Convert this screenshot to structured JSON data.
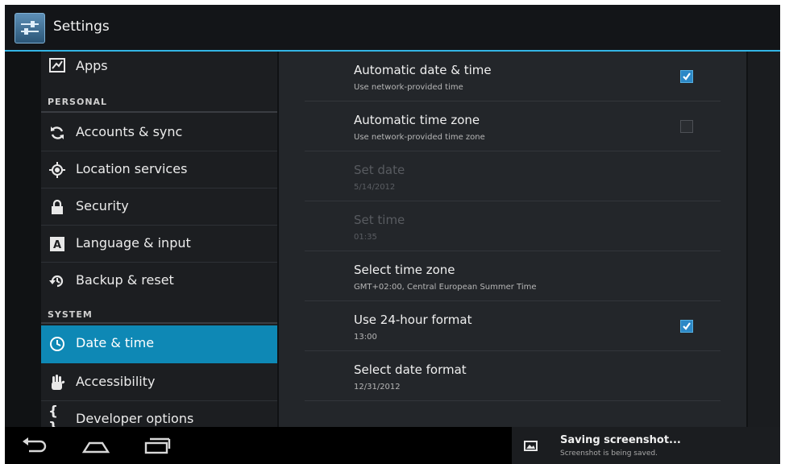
{
  "app": {
    "title": "Settings"
  },
  "sidebar": {
    "apps": {
      "label": "Apps",
      "icon": "apps-icon"
    },
    "personal_header": "PERSONAL",
    "personal": [
      {
        "label": "Accounts & sync",
        "icon": "sync-icon"
      },
      {
        "label": "Location services",
        "icon": "location-icon"
      },
      {
        "label": "Security",
        "icon": "lock-icon"
      },
      {
        "label": "Language & input",
        "icon": "language-icon"
      },
      {
        "label": "Backup & reset",
        "icon": "backup-icon"
      }
    ],
    "system_header": "SYSTEM",
    "system": [
      {
        "label": "Date & time",
        "icon": "clock-icon",
        "selected": true
      },
      {
        "label": "Accessibility",
        "icon": "hand-icon"
      },
      {
        "label": "Developer options",
        "icon": "braces-icon"
      }
    ]
  },
  "prefs": [
    {
      "title": "Automatic date & time",
      "summary": "Use network-provided time",
      "checkbox": true,
      "checked": true,
      "enabled": true
    },
    {
      "title": "Automatic time zone",
      "summary": "Use network-provided time zone",
      "checkbox": true,
      "checked": false,
      "enabled": true
    },
    {
      "title": "Set date",
      "summary": "5/14/2012",
      "checkbox": false,
      "enabled": false
    },
    {
      "title": "Set time",
      "summary": "01:35",
      "checkbox": false,
      "enabled": false
    },
    {
      "title": "Select time zone",
      "summary": "GMT+02:00, Central European Summer Time",
      "checkbox": false,
      "enabled": true
    },
    {
      "title": "Use 24-hour format",
      "summary": "13:00",
      "checkbox": true,
      "checked": true,
      "enabled": true
    },
    {
      "title": "Select date format",
      "summary": "12/31/2012",
      "checkbox": false,
      "enabled": true
    }
  ],
  "navbar": {
    "buttons": [
      "back-icon",
      "home-icon",
      "recents-icon"
    ]
  },
  "toast": {
    "title": "Saving screenshot...",
    "subtitle": "Screenshot is being saved."
  },
  "colors": {
    "accent": "#33b5e5",
    "selected": "#0e88b5",
    "checkbox": "#2c88c6"
  }
}
